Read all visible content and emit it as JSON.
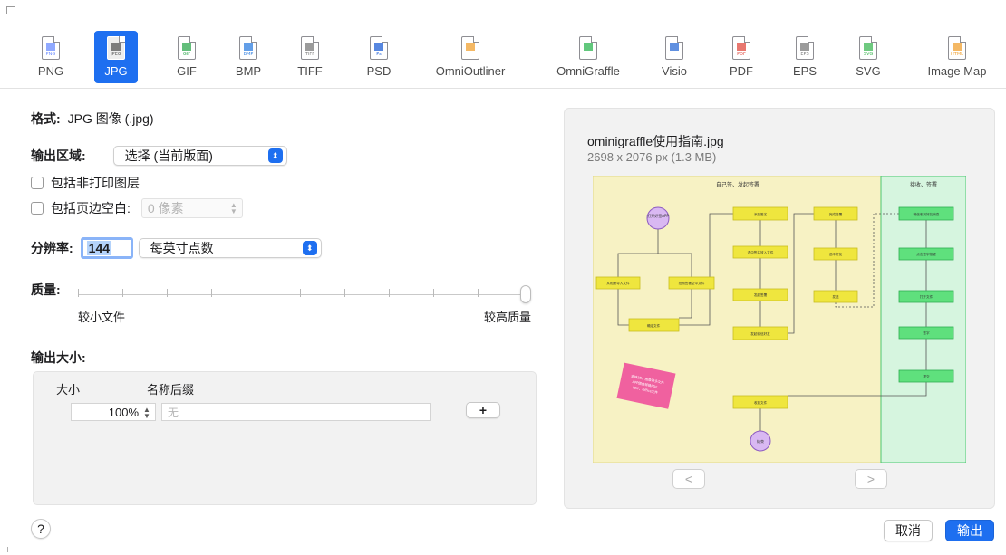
{
  "formats": [
    {
      "label": "PNG",
      "tag": "PNG",
      "icon": "png-file-icon",
      "color": "#6b8cff"
    },
    {
      "label": "JPG",
      "tag": "JPEG",
      "icon": "jpg-file-icon",
      "color": "#555555",
      "selected": true
    },
    {
      "label": "GIF",
      "tag": "GIF",
      "icon": "gif-file-icon",
      "color": "#2fa84f"
    },
    {
      "label": "BMP",
      "tag": "BMP",
      "icon": "bmp-file-icon",
      "color": "#2f7fe0"
    },
    {
      "label": "TIFF",
      "tag": "TIFF",
      "icon": "tiff-file-icon",
      "color": "#7a7a7a"
    },
    {
      "label": "PSD",
      "tag": "Ps",
      "icon": "psd-file-icon",
      "color": "#1f5fd6"
    },
    {
      "label": "OmniOutliner",
      "tag": "",
      "icon": "omnioutliner-file-icon",
      "color": "#f0a030"
    },
    {
      "label": "OmniGraffle",
      "tag": "",
      "icon": "omnigraffle-file-icon",
      "color": "#2db552"
    },
    {
      "label": "Visio",
      "tag": "",
      "icon": "visio-file-icon",
      "color": "#2b6bd6"
    },
    {
      "label": "PDF",
      "tag": "PDF",
      "icon": "pdf-file-icon",
      "color": "#e04a3f"
    },
    {
      "label": "EPS",
      "tag": "EPS",
      "icon": "eps-file-icon",
      "color": "#7a7a7a"
    },
    {
      "label": "SVG",
      "tag": "SVG",
      "icon": "svg-file-icon",
      "color": "#3fb855"
    },
    {
      "label": "Image Map",
      "tag": "HTML",
      "icon": "html-file-icon",
      "color": "#f0a030"
    }
  ],
  "settings": {
    "format_label": "格式:",
    "format_value": "JPG 图像 (.jpg)",
    "region_label": "输出区域:",
    "region_value": "选择 (当前版面)",
    "include_nonprint": "包括非打印图层",
    "include_margin": "包括页边空白:",
    "margin_value": "0 像素",
    "resolution_label": "分辨率:",
    "resolution_value": "144",
    "resolution_unit": "每英寸点数",
    "quality_label": "质量:",
    "quality_min": "较小文件",
    "quality_max": "较高质量",
    "quality_level": 1.0
  },
  "output_size": {
    "title": "输出大小:",
    "col_size": "大小",
    "col_suffix": "名称后缀",
    "size_value": "100%",
    "suffix_placeholder": "无",
    "add_label": "+"
  },
  "preview": {
    "filename": "ominigraffle使用指南.jpg",
    "dimensions": "2698 x 2076 px (1.3 MB)",
    "prev_label": "<",
    "next_label": ">",
    "diagram": {
      "lane1_title": "自己签、发起签署",
      "lane2_title": "接收、签署",
      "start": "打开\n好签\nAPP",
      "end": "结束",
      "note": "支持3D、图像等多文件\nAPP图像转换PDF、\nPDF、Office文件",
      "nodes": [
        "从相册导入文件",
        "拍照签署空中文件",
        "确定文件",
        "添加签名",
        "选中签名放入文件",
        "发起签署",
        "发起微信好友",
        "完成签署",
        "选中好友",
        "发送",
        "微信收到好友消息",
        "点击签字按键",
        "打开文件",
        "签字",
        "提交",
        "收到文件"
      ]
    }
  },
  "footer": {
    "help": "?",
    "cancel": "取消",
    "export": "输出"
  }
}
